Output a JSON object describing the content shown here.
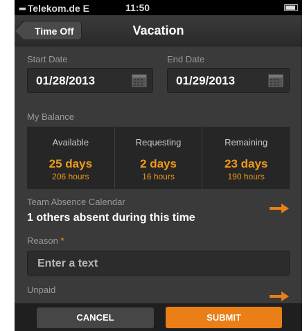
{
  "statusbar": {
    "carrier": "Telekom.de E",
    "time": "11:50"
  },
  "navbar": {
    "back_label": "Time Off",
    "title": "Vacation"
  },
  "start_date": {
    "label": "Start Date",
    "value": "01/28/2013"
  },
  "end_date": {
    "label": "End Date",
    "value": "01/29/2013"
  },
  "balance": {
    "label": "My Balance",
    "cells": [
      {
        "title": "Available",
        "days": "25 days",
        "hours": "206 hours"
      },
      {
        "title": "Requesting",
        "days": "2 days",
        "hours": "16 hours"
      },
      {
        "title": "Remaining",
        "days": "23 days",
        "hours": "190 hours"
      }
    ]
  },
  "team_absence": {
    "label": "Team Absence Calendar",
    "summary": "1 others absent during this time"
  },
  "reason": {
    "label": "Reason",
    "required_mark": "*",
    "placeholder": "Enter a text"
  },
  "unpaid": {
    "label": "Unpaid"
  },
  "toolbar": {
    "cancel_label": "CANCEL",
    "submit_label": "SUBMIT"
  },
  "colors": {
    "accent": "#ea7e17",
    "background": "#3a3a3a"
  }
}
